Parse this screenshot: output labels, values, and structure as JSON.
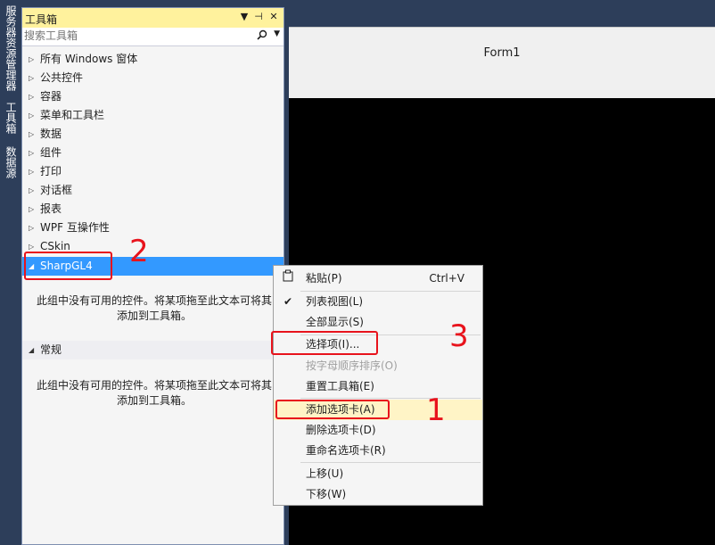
{
  "side_tabs": [
    "服务器资源管理器",
    "工具箱",
    "数据源"
  ],
  "toolbox": {
    "title": "工具箱",
    "icons": {
      "dropdown": "▼",
      "pin": "⊣",
      "close": "✕"
    },
    "search_placeholder": "搜索工具箱",
    "categories": [
      {
        "label": "所有 Windows 窗体",
        "expanded": false
      },
      {
        "label": "公共控件",
        "expanded": false
      },
      {
        "label": "容器",
        "expanded": false
      },
      {
        "label": "菜单和工具栏",
        "expanded": false
      },
      {
        "label": "数据",
        "expanded": false
      },
      {
        "label": "组件",
        "expanded": false
      },
      {
        "label": "打印",
        "expanded": false
      },
      {
        "label": "对话框",
        "expanded": false
      },
      {
        "label": "报表",
        "expanded": false
      },
      {
        "label": "WPF 互操作性",
        "expanded": false
      },
      {
        "label": "CSkin",
        "expanded": false
      },
      {
        "label": "SharpGL4",
        "expanded": true,
        "selected": true
      },
      {
        "label": "常规",
        "expanded": true
      }
    ],
    "empty_message_line1": "此组中没有可用的控件。将某项拖至此文本可将其",
    "empty_message_line2": "添加到工具箱。"
  },
  "designer": {
    "form_title": "Form1"
  },
  "context_menu": {
    "items": [
      {
        "label": "粘贴(P)",
        "shortcut": "Ctrl+V",
        "icon": "paste-icon"
      },
      {
        "label": "列表视图(L)",
        "checked": true
      },
      {
        "label": "全部显示(S)"
      },
      {
        "label": "选择项(I)..."
      },
      {
        "label": "按字母顺序排序(O)",
        "disabled": true
      },
      {
        "label": "重置工具箱(E)"
      },
      {
        "label": "添加选项卡(A)",
        "highlighted": true
      },
      {
        "label": "删除选项卡(D)"
      },
      {
        "label": "重命名选项卡(R)"
      },
      {
        "label": "上移(U)"
      },
      {
        "label": "下移(W)"
      }
    ]
  },
  "annotations": [
    "1",
    "2",
    "3"
  ],
  "colors": {
    "accent": "#3399ff",
    "annotation": "#e8131c",
    "title_bar": "#fff29d",
    "highlight": "#fff4c6"
  }
}
